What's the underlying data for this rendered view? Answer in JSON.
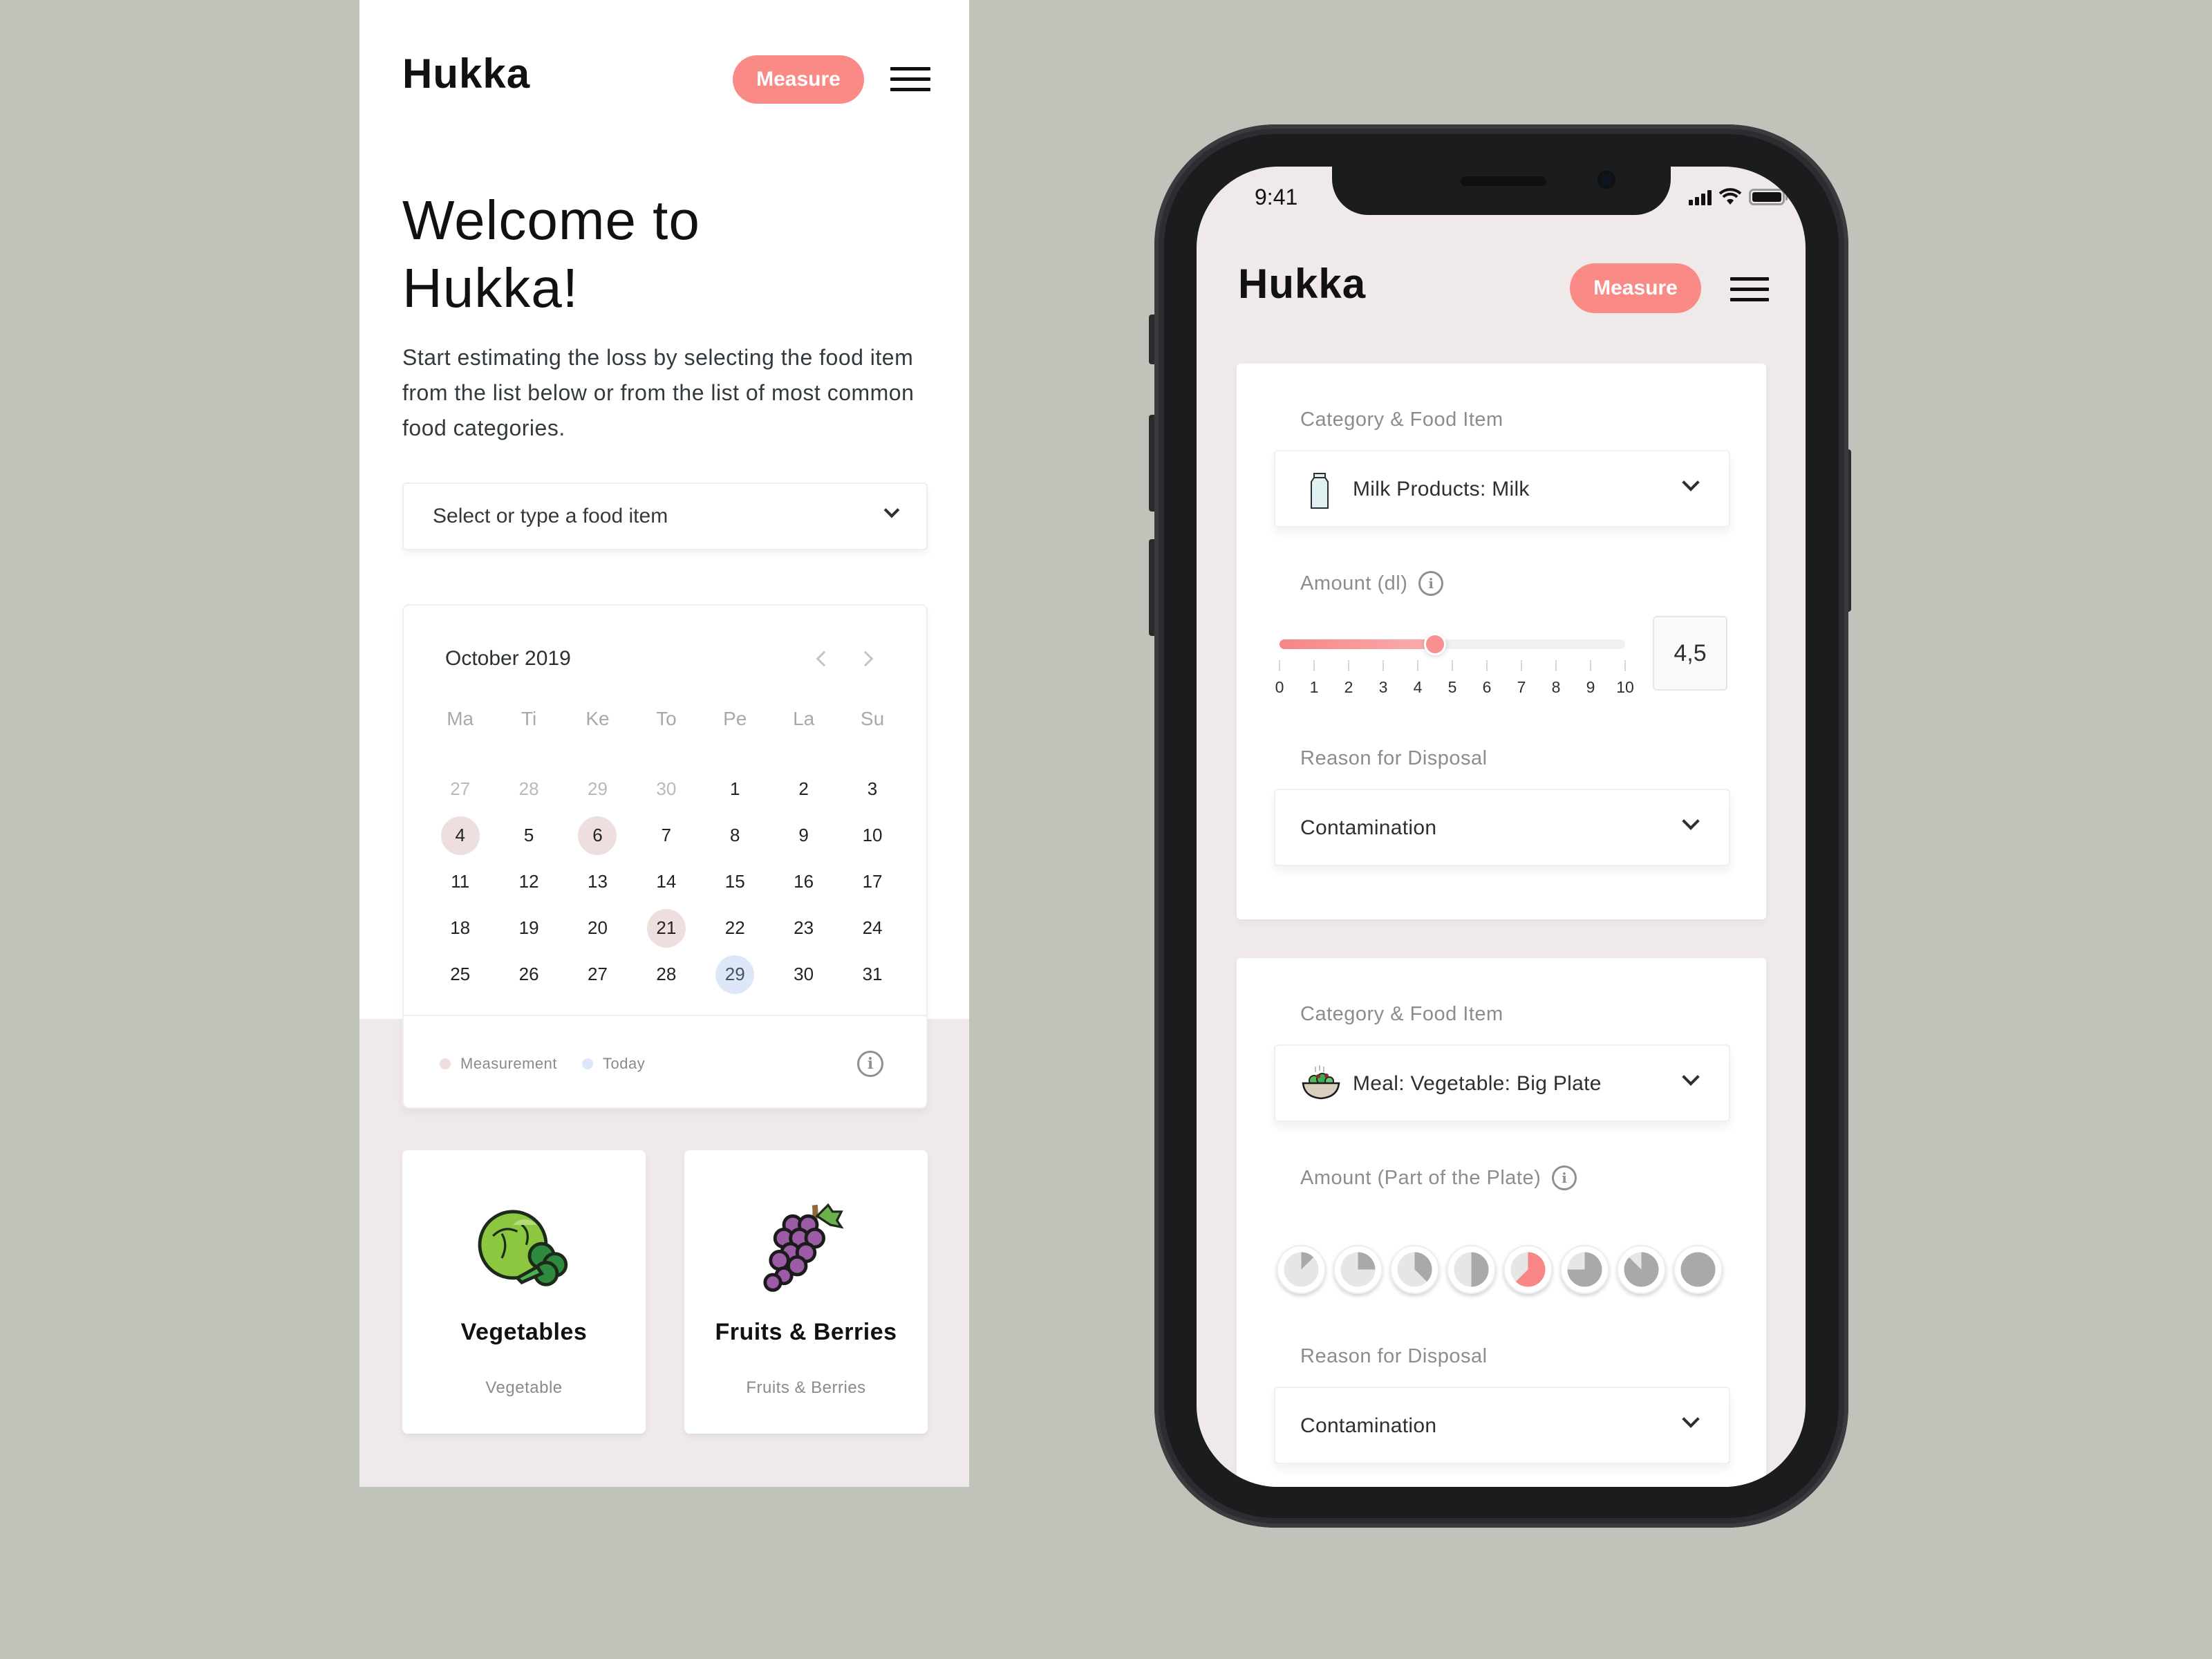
{
  "app": {
    "name": "Hukka",
    "measure_label": "Measure"
  },
  "welcome": {
    "title": "Welcome to Hukka!",
    "intro": "Start estimating the loss by selecting the food item from the list below or from the list of most common food categories.",
    "select_placeholder": "Select or type a food item"
  },
  "calendar": {
    "title": "October 2019",
    "weekdays": [
      "Ma",
      "Ti",
      "Ke",
      "To",
      "Pe",
      "La",
      "Su"
    ],
    "weeks": [
      [
        {
          "d": "27",
          "muted": true
        },
        {
          "d": "28",
          "muted": true
        },
        {
          "d": "29",
          "muted": true
        },
        {
          "d": "30",
          "muted": true
        },
        {
          "d": "1"
        },
        {
          "d": "2"
        },
        {
          "d": "3"
        }
      ],
      [
        {
          "d": "4",
          "mark": "measurement"
        },
        {
          "d": "5"
        },
        {
          "d": "6",
          "mark": "measurement"
        },
        {
          "d": "7"
        },
        {
          "d": "8"
        },
        {
          "d": "9"
        },
        {
          "d": "10"
        }
      ],
      [
        {
          "d": "11"
        },
        {
          "d": "12"
        },
        {
          "d": "13"
        },
        {
          "d": "14"
        },
        {
          "d": "15"
        },
        {
          "d": "16"
        },
        {
          "d": "17"
        }
      ],
      [
        {
          "d": "18"
        },
        {
          "d": "19"
        },
        {
          "d": "20"
        },
        {
          "d": "21",
          "mark": "measurement"
        },
        {
          "d": "22"
        },
        {
          "d": "23"
        },
        {
          "d": "24"
        }
      ],
      [
        {
          "d": "25"
        },
        {
          "d": "26"
        },
        {
          "d": "27"
        },
        {
          "d": "28"
        },
        {
          "d": "29",
          "mark": "today"
        },
        {
          "d": "30"
        },
        {
          "d": "31"
        }
      ]
    ],
    "legend": [
      {
        "label": "Measurement",
        "color": "#efdede"
      },
      {
        "label": "Today",
        "color": "#dde7f8"
      }
    ]
  },
  "categories": [
    {
      "name": "Vegetables",
      "sub": "Vegetable",
      "icon": "cabbage-broccoli-icon"
    },
    {
      "name": "Fruits & Berries",
      "sub": "Fruits & Berries",
      "icon": "grapes-icon"
    }
  ],
  "phone": {
    "status_time": "9:41",
    "entries": [
      {
        "category_label": "Category & Food Item",
        "food_item": "Milk Products: Milk",
        "food_icon": "milk-carton-icon",
        "amount_label": "Amount (dl)",
        "amount_value": "4,5",
        "slider": {
          "min": 0,
          "max": 10,
          "value": 4.5,
          "ticks": [
            "0",
            "1",
            "2",
            "3",
            "4",
            "5",
            "6",
            "7",
            "8",
            "9",
            "10"
          ]
        },
        "reason_label": "Reason for Disposal",
        "reason_value": "Contamination"
      },
      {
        "category_label": "Category & Food Item",
        "food_item": "Meal: Vegetable: Big Plate",
        "food_icon": "salad-bowl-icon",
        "amount_label": "Amount (Part of the Plate)",
        "plate_options": [
          "1/8",
          "2/8",
          "3/8",
          "4/8",
          "5/8",
          "6/8",
          "7/8",
          "8/8"
        ],
        "plate_selected": "5/8",
        "reason_label": "Reason for Disposal",
        "reason_value": "Contamination"
      }
    ]
  },
  "colors": {
    "accent": "#fa8a86",
    "background": "#c0c3ba",
    "screen_bg": "#efe9e9",
    "measurement": "#efdede",
    "today": "#dde7f8"
  }
}
